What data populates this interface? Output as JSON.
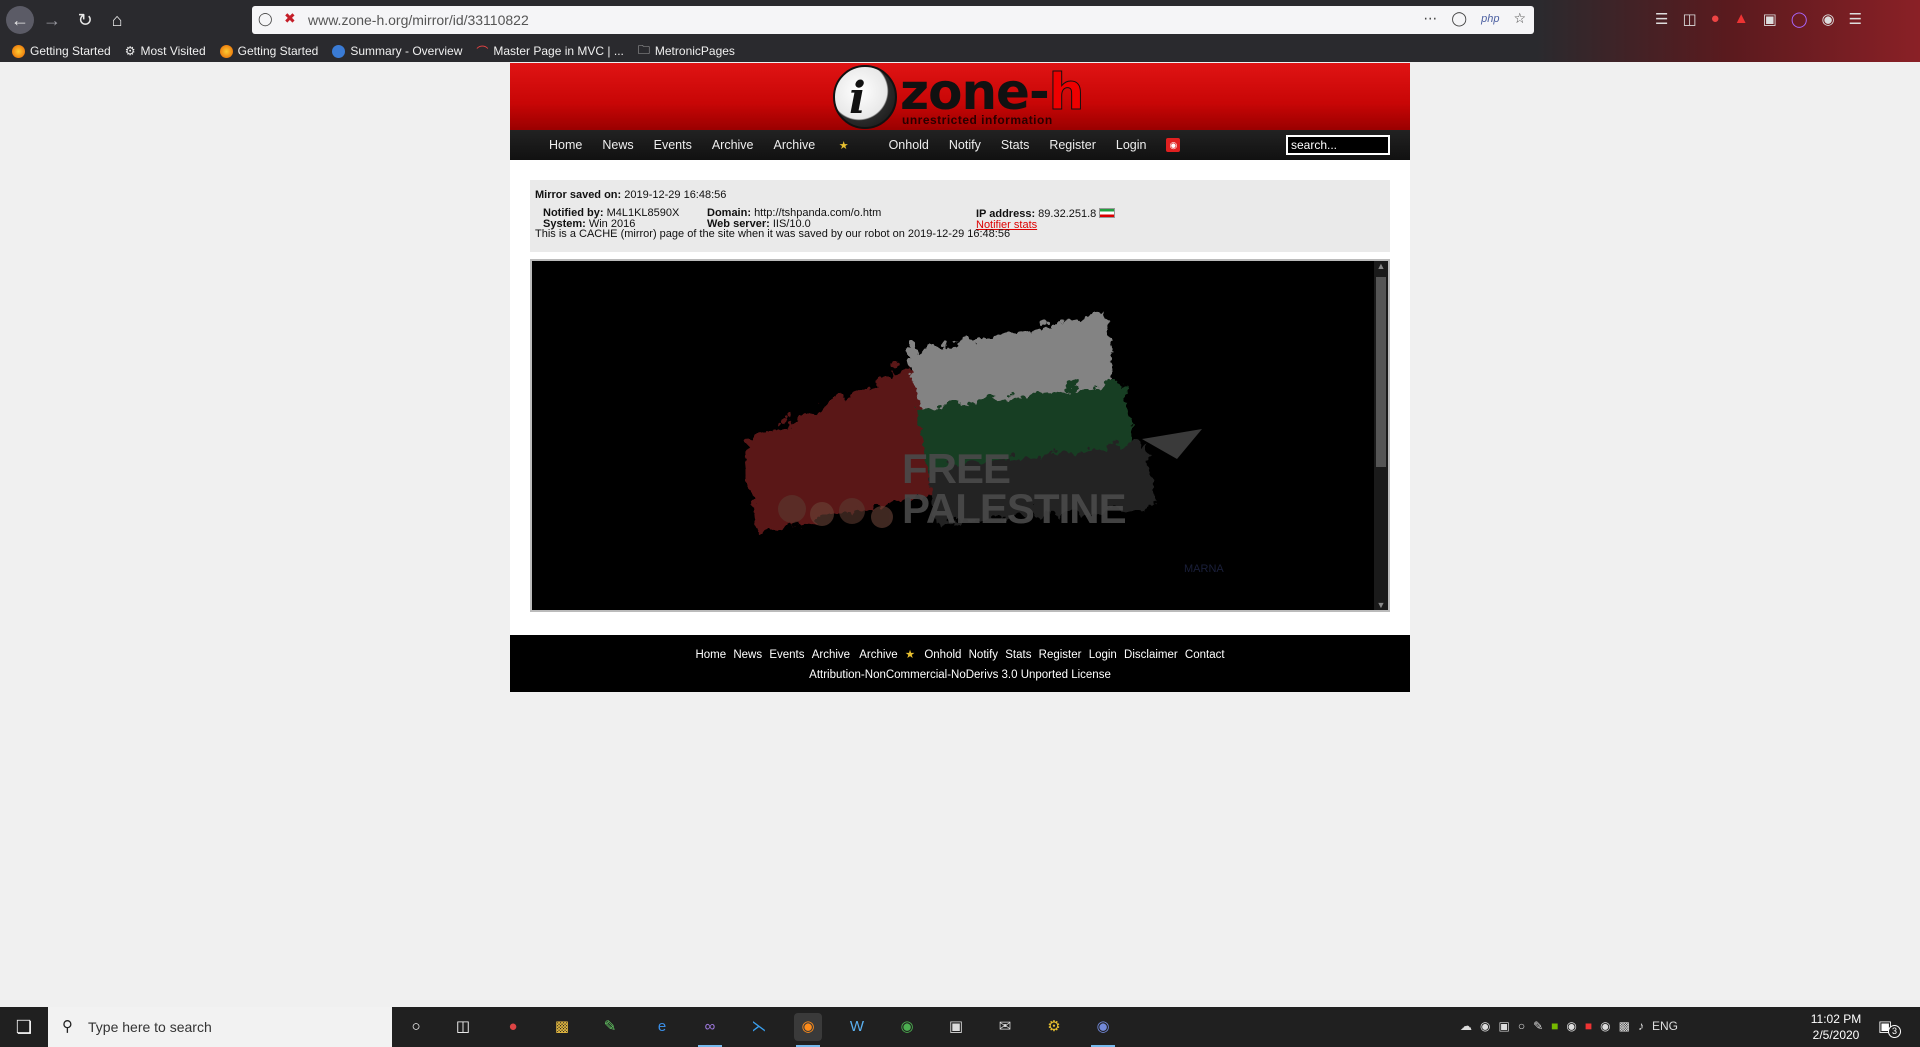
{
  "browser": {
    "url": "www.zone-h.org/mirror/id/33110822",
    "php_badge": "php",
    "bookmarks": [
      {
        "label": "Getting Started",
        "icon": "firefox-icon"
      },
      {
        "label": "Most Visited",
        "icon": "gear-icon"
      },
      {
        "label": "Getting Started",
        "icon": "firefox-icon"
      },
      {
        "label": "Summary - Overview",
        "icon": "globe-icon"
      },
      {
        "label": "Master Page in MVC | ...",
        "icon": "page-icon"
      },
      {
        "label": "MetronicPages",
        "icon": "folder-icon"
      }
    ]
  },
  "site": {
    "logo_text_prefix": "zone-",
    "logo_text_suffix": "h",
    "logo_tagline": "unrestricted information",
    "nav": [
      "Home",
      "News",
      "Events",
      "Archive",
      "Archive",
      "Onhold",
      "Notify",
      "Stats",
      "Register",
      "Login"
    ],
    "search_placeholder": "search..."
  },
  "mirror_info": {
    "saved_label": "Mirror saved on:",
    "saved_value": "2019-12-29 16:48:56",
    "notified_label": "Notified by:",
    "notified_value": "M4L1KL8590X",
    "domain_label": "Domain:",
    "domain_value": "http://tshpanda.com/o.htm",
    "ip_label": "IP address:",
    "ip_value": "89.32.251.8",
    "system_label": "System:",
    "system_value": "Win 2016",
    "webserver_label": "Web server:",
    "webserver_value": "IIS/10.0",
    "notifier_stats": "Notifier stats",
    "cache_note": "This is a CACHE (mirror) page of the site when it was saved by our robot on 2019-12-29 16:48:56"
  },
  "mirror_content": {
    "line1": "FREE",
    "line2": "PALESTINE",
    "watermark": "MARNA"
  },
  "footer": {
    "links": [
      "Home",
      "News",
      "Events",
      "Archive",
      "Archive",
      "Onhold",
      "Notify",
      "Stats",
      "Register",
      "Login",
      "Disclaimer",
      "Contact"
    ],
    "license": "Attribution-NonCommercial-NoDerivs 3.0 Unported License"
  },
  "taskbar": {
    "search_placeholder": "Type here to search",
    "lang": "ENG",
    "time": "11:02 PM",
    "date": "2/5/2020",
    "notification_count": "3"
  },
  "colors": {
    "banner_red": "#c80606",
    "nav_black": "#111111",
    "accent_link": "#dd0000"
  }
}
